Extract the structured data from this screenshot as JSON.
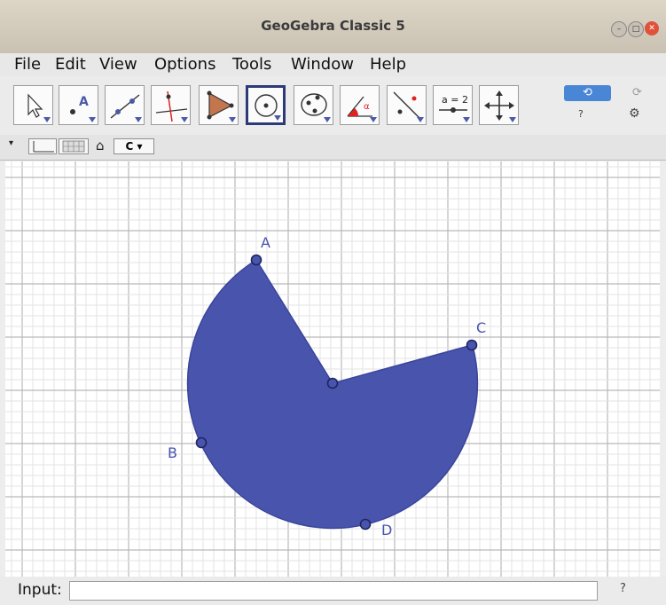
{
  "window": {
    "title": "GeoGebra Classic 5",
    "controls": [
      "minimize",
      "maximize",
      "close"
    ]
  },
  "menu": [
    "File",
    "Edit",
    "View",
    "Options",
    "Tools",
    "Window",
    "Help"
  ],
  "toolbar": {
    "tools": [
      {
        "name": "move-tool-icon",
        "selected": false
      },
      {
        "name": "point-tool-icon",
        "selected": false,
        "text": "A"
      },
      {
        "name": "line-tool-icon",
        "selected": false
      },
      {
        "name": "perpendicular-tool-icon",
        "selected": false
      },
      {
        "name": "polygon-tool-icon",
        "selected": false
      },
      {
        "name": "circle-tool-icon",
        "selected": true
      },
      {
        "name": "ellipse-tool-icon",
        "selected": false
      },
      {
        "name": "angle-tool-icon",
        "selected": false,
        "text": "α"
      },
      {
        "name": "reflect-tool-icon",
        "selected": false
      },
      {
        "name": "slider-tool-icon",
        "selected": false,
        "text": "a = 2"
      },
      {
        "name": "move-graphics-tool-icon",
        "selected": false
      }
    ],
    "undo_label": "⟲",
    "redo_label": "⟳",
    "help_label": "?",
    "settings_label": "⚙"
  },
  "stylebar": {
    "toggle": "▾",
    "home": "⌂",
    "point_capture": "C ▾"
  },
  "graphics": {
    "sector_color": "#4954ad",
    "point_labels": [
      "A",
      "B",
      "C",
      "D"
    ],
    "center_point": ""
  },
  "input": {
    "label": "Input:",
    "value": "",
    "help": "?"
  }
}
